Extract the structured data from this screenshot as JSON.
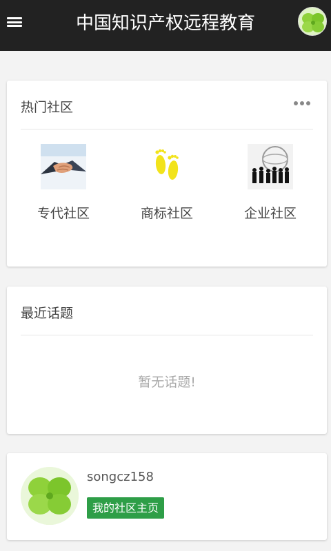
{
  "header": {
    "title": "中国知识产权远程教育",
    "menu_icon": "hamburger-menu-icon",
    "avatar_icon": "four-leaf-clover-avatar"
  },
  "hot_communities": {
    "title": "热门社区",
    "more_icon": "ellipsis-icon",
    "items": [
      {
        "label": "专代社区",
        "icon": "handshake-image"
      },
      {
        "label": "商标社区",
        "icon": "footprints-image"
      },
      {
        "label": "企业社区",
        "icon": "business-people-image"
      }
    ]
  },
  "recent_topics": {
    "title": "最近话题",
    "empty_text": "暂无话题!"
  },
  "user": {
    "username": "songcz158",
    "home_button": "我的社区主页",
    "avatar_icon": "four-leaf-clover-avatar"
  },
  "colors": {
    "header_bg": "#222222",
    "accent_green": "#2e9e47",
    "page_bg": "#f3f3f3"
  }
}
